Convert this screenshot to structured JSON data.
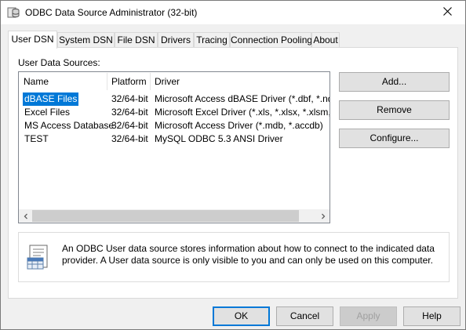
{
  "window": {
    "title": "ODBC Data Source Administrator (32-bit)",
    "app_icon": "odbc-app-icon",
    "close_icon": "close-icon"
  },
  "tabs": [
    {
      "label": "User DSN",
      "active": true
    },
    {
      "label": "System DSN",
      "active": false
    },
    {
      "label": "File DSN",
      "active": false
    },
    {
      "label": "Drivers",
      "active": false
    },
    {
      "label": "Tracing",
      "active": false
    },
    {
      "label": "Connection Pooling",
      "active": false
    },
    {
      "label": "About",
      "active": false
    }
  ],
  "panel": {
    "label": "User Data Sources:",
    "columns": {
      "name": "Name",
      "platform": "Platform",
      "driver": "Driver"
    },
    "rows": [
      {
        "name": "dBASE Files",
        "platform": "32/64-bit",
        "driver": "Microsoft Access dBASE Driver (*.dbf, *.ndx, *.mdx)",
        "selected": true
      },
      {
        "name": "Excel Files",
        "platform": "32/64-bit",
        "driver": "Microsoft Excel Driver (*.xls, *.xlsx, *.xlsm, *.xlsb)",
        "selected": false
      },
      {
        "name": "MS Access Database",
        "platform": "32/64-bit",
        "driver": "Microsoft Access Driver (*.mdb, *.accdb)",
        "selected": false
      },
      {
        "name": "TEST",
        "platform": "32/64-bit",
        "driver": "MySQL ODBC 5.3 ANSI Driver",
        "selected": false
      }
    ],
    "buttons": {
      "add": "Add...",
      "remove": "Remove",
      "configure": "Configure..."
    },
    "info_text": "An ODBC User data source stores information about how to connect to the indicated data provider.   A User data source is only visible to you and can only be used on this computer.",
    "info_icon": "data-source-document-icon"
  },
  "footer": {
    "ok": "OK",
    "cancel": "Cancel",
    "apply": "Apply",
    "help": "Help"
  },
  "colors": {
    "selection": "#0078d7",
    "default_button_border": "#0078d7"
  }
}
